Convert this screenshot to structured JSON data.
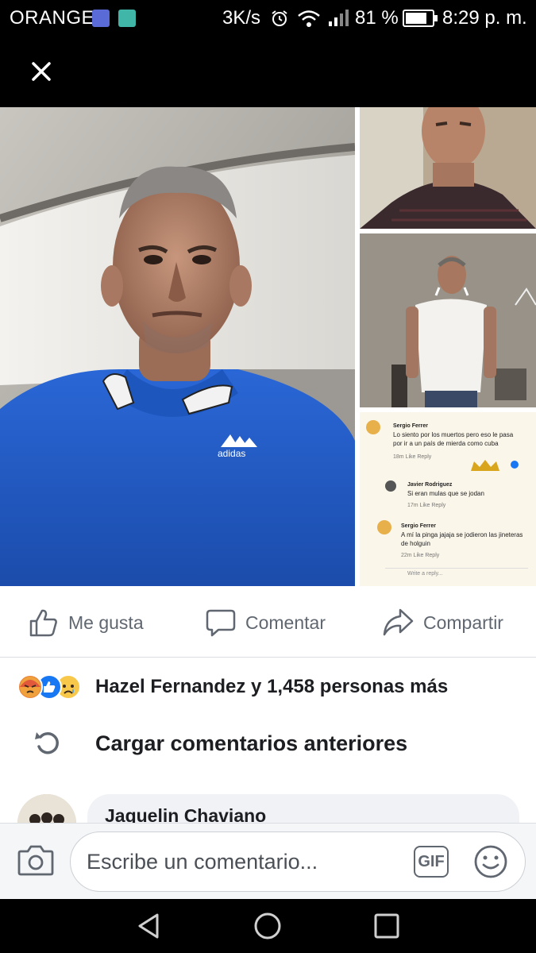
{
  "status_bar": {
    "carrier": "ORANGE",
    "speed": "3K/s",
    "battery_percent": "81 %",
    "battery_level": 0.81,
    "time": "8:29 p. m."
  },
  "top_bar": {
    "close_icon": "close-icon"
  },
  "screenshot_comments": [
    {
      "author": "Sergio Ferrer",
      "text": "Lo siento por los muertos pero eso le pasa por ir a un  país de mierda como cuba",
      "meta": "18m   Like   Reply"
    },
    {
      "author": "Javier Rodriguez",
      "text": "Si eran mulas que se jodan",
      "meta": "17m   Like   Reply"
    },
    {
      "author": "Sergio Ferrer",
      "text": "A mí la pinga jajaja se jodieron las jineteras de holguin",
      "meta": "22m   Like   Reply"
    }
  ],
  "screenshot_reply_placeholder": "Write a reply...",
  "actions": {
    "like": "Me gusta",
    "comment": "Comentar",
    "share": "Compartir"
  },
  "reactions": {
    "icons": [
      "angry-icon",
      "like-icon",
      "sad-icon"
    ],
    "summary": "Hazel Fernandez y 1,458 personas más"
  },
  "load_more": "Cargar comentarios anteriores",
  "first_comment": {
    "author": "Jaquelin Chaviano"
  },
  "composer": {
    "placeholder": "Escribe un comentario...",
    "gif_label": "GIF"
  },
  "colors": {
    "accent": "#1877f2",
    "icon_gray": "#606770"
  }
}
